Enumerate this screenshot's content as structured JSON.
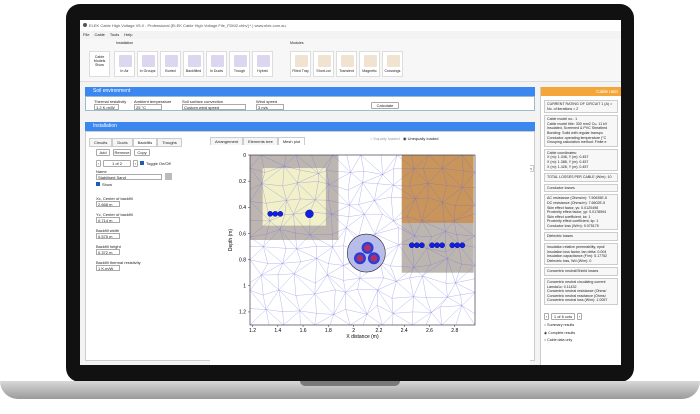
{
  "window": {
    "title": "ELEK Cable High Voltage V5.0 - Professional [ELEK Cable High Voltage File_FDM2.cbhv] * | www.elek.com.au"
  },
  "menu": [
    "File",
    "Cable",
    "Tools",
    "Help"
  ],
  "ribbon": {
    "installation_label": "Installation",
    "modules_label": "Modules",
    "models_btn": "Cable Models Show",
    "installation": [
      "In Air",
      "In Groups",
      "Buried",
      "Backfilled",
      "In Ducts",
      "Trough",
      "Hybrid"
    ],
    "modules": [
      "Filled Tray",
      "Short-cct",
      "Transient",
      "Magnetic",
      "Crossings"
    ]
  },
  "soil": {
    "title": "Soil environment",
    "thermal_label": "Thermal resistivity",
    "thermal": "1.2 K.m/W",
    "ambient_label": "Ambient temperature",
    "ambient": "25 °C",
    "surface_label": "Soil surface convection",
    "surface": "Custom wind speed",
    "wind_label": "Wind speed",
    "wind": "3 m/s",
    "calculate": "Calculate"
  },
  "installation": {
    "title": "Installation",
    "tabs": [
      "Circuits",
      "Ducts",
      "Backfills",
      "Troughs"
    ],
    "active_tab": "Backfills",
    "add": "Add",
    "remove": "Remove",
    "copy": "Copy",
    "pager": "1 of 2",
    "toggle": "Toggle On/Off",
    "name_label": "Name",
    "name": "Stabilised Sand",
    "show": "Show",
    "fields": [
      {
        "label": "Xc, Center of backfill",
        "value": "2.668 m"
      },
      {
        "label": "Yc, Center of backfill",
        "value": "0.714 m"
      },
      {
        "label": "Backfill width",
        "value": "0.575 m"
      },
      {
        "label": "Backfill height",
        "value": "0.372 m"
      },
      {
        "label": "Backfill thermal resistivity",
        "value": "1 K.m/W"
      }
    ]
  },
  "view": {
    "tabs": [
      "Arrangement",
      "Elements tree",
      "Mesh plot"
    ],
    "active_tab": "Mesh plot",
    "radio_equal": "Equally loaded",
    "radio_unequal": "Unequally loaded",
    "side_label": "Use m"
  },
  "chart_data": {
    "type": "mesh",
    "xlabel": "X distance (m)",
    "ylabel": "Depth (m)",
    "xlim": [
      1.18,
      2.96
    ],
    "ylim": [
      1.3,
      0
    ],
    "xticks": [
      "1.2",
      "1.4",
      "1.6",
      "1.8",
      "2",
      "2.2",
      "2.4",
      "2.6",
      "2.8"
    ],
    "yticks": [
      "0",
      "0.2",
      "0.4",
      "0.6",
      "0.8",
      "1",
      "1.2"
    ],
    "regions": [
      {
        "x": [
          1.18,
          1.88
        ],
        "y": [
          0,
          0.65
        ],
        "color": "#bdb6b0"
      },
      {
        "x": [
          1.28,
          1.78
        ],
        "y": [
          0.1,
          0.54
        ],
        "color": "#f2f0c8"
      },
      {
        "x": [
          2.38,
          2.95
        ],
        "y": [
          0,
          0.52
        ],
        "color": "#c9955a"
      },
      {
        "x": [
          2.38,
          2.95
        ],
        "y": [
          0.52,
          0.9
        ],
        "color": "#bdb6b0"
      }
    ],
    "cable_groups": [
      {
        "x": [
          1.34,
          1.38,
          1.42
        ],
        "y": 0.45
      },
      {
        "x": [
          1.65
        ],
        "y": 0.45
      },
      {
        "x": [
          2.46,
          2.5,
          2.54
        ],
        "y": 0.69
      },
      {
        "x": [
          2.62,
          2.66,
          2.7
        ],
        "y": 0.69
      },
      {
        "x": [
          2.78,
          2.82,
          2.86
        ],
        "y": 0.69
      }
    ],
    "main_cable": {
      "x": 2.1,
      "y": 0.75,
      "cores": [
        [
          2.11,
          0.71
        ],
        [
          2.05,
          0.79
        ],
        [
          2.16,
          0.79
        ]
      ]
    },
    "mesh_color": "#6a6ae0"
  },
  "results": {
    "title": "Cable ratin",
    "lines1": [
      "CURRENT RATING OF CIRCUIT 1 (A) =",
      "No. of iterations = 2"
    ],
    "lines2": [
      "Cable model no.: 1",
      "Cable model title: 300 mm2 Cu, 11 kV",
      "Insulated, Screened & PVC Sheathed",
      "Bonding: Solid with regular transpo",
      "Conductor operating temperature (°C",
      "Grouping calculation method: Finite e"
    ],
    "lines3": [
      "Cable coordinates:",
      "X (m): 1.348, Y (m): 0.457",
      "X (m): 1.388, Y (m): 0.457",
      "X (m): 1.428, Y (m): 0.457"
    ],
    "total": "TOTAL LOSSES PER CABLE (W/m): 10",
    "cond_title": "Conductor losses",
    "cond": [
      "AC resistance (Ohms/m): 7.90635E-5",
      "DC resistance (Ohms/m): 7.6602E-5",
      "Skin effect factor, ys: 0.0120498",
      "Proximity effect factor, yp: 0.0178594",
      "Skin effect coefficient, ks: 1",
      "Proximity effect coefficient, kp: 1",
      "Conductor loss (W/m): 9.075175"
    ],
    "diel_title": "Dielectric losses",
    "diel": [
      "Insulation relative permeability, epsil",
      "Insulation loss factor, tan delta: 0.004",
      "Insulation capacitance (F/m): 5.17752",
      "Dielectric loss, Wd (W/m): 0"
    ],
    "conc_title": "Concentric neutral/Shield losses",
    "conc": [
      "Concentric neutral circulating current",
      "Lamda1c: 0.11432",
      "Concentric neutral resistance (Ohms/",
      "Concentric neutral reactance (Ohms/",
      "Concentric neutral loss (W/m): 1.0057"
    ],
    "pager": "1 of 6 ccts",
    "opt_summary": "Summary results",
    "opt_complete": "Complete results",
    "opt_cable": "Cable data only"
  }
}
